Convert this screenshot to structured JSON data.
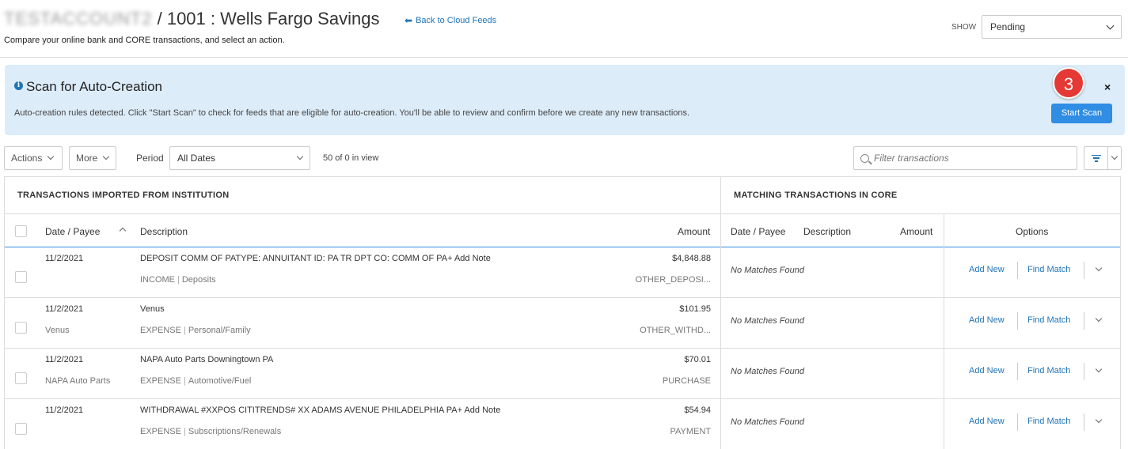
{
  "header": {
    "account_name": "TESTACCOUNT2",
    "title": "/ 1001 : Wells Fargo Savings",
    "back_link": "Back to Cloud Feeds",
    "subtitle": "Compare your online bank and CORE transactions, and select an action.",
    "show_label": "SHOW",
    "show_value": "Pending"
  },
  "banner": {
    "title": "Scan for Auto-Creation",
    "text": "Auto-creation rules detected. Click \"Start Scan\" to check for feeds that are eligible for auto-creation. You'll be able to review and confirm before we create any new transactions.",
    "step_number": "3",
    "close": "×",
    "start_scan": "Start Scan"
  },
  "toolbar": {
    "actions": "Actions",
    "more": "More",
    "period_label": "Period",
    "period_value": "All Dates",
    "in_view": "50 of 0 in view",
    "filter_placeholder": "Filter transactions"
  },
  "table": {
    "group_left": "TRANSACTIONS IMPORTED FROM INSTITUTION",
    "group_right": "MATCHING TRANSACTIONS IN CORE",
    "col_date": "Date / Payee",
    "col_desc": "Description",
    "col_amount": "Amount",
    "col_core_date": "Date / Payee",
    "col_core_desc": "Description",
    "col_core_amount": "Amount",
    "col_options": "Options",
    "add_new": "Add New",
    "find_match": "Find Match",
    "no_match": "No Matches Found",
    "rows": [
      {
        "date": "11/2/2021",
        "payee": "",
        "desc": "DEPOSIT COMM OF PATYPE: ANNUITANT ID: PA TR DPT CO: COMM OF PA+ Add Note",
        "cat": "INCOME",
        "subcat": "Deposits",
        "amount": "$4,848.88",
        "type": "OTHER_DEPOSI..."
      },
      {
        "date": "11/2/2021",
        "payee": "Venus",
        "desc": "Venus",
        "cat": "EXPENSE",
        "subcat": "Personal/Family",
        "amount": "$101.95",
        "type": "OTHER_WITHD..."
      },
      {
        "date": "11/2/2021",
        "payee": "NAPA Auto Parts",
        "desc": "NAPA Auto Parts Downingtown PA",
        "cat": "EXPENSE",
        "subcat": "Automotive/Fuel",
        "amount": "$70.01",
        "type": "PURCHASE"
      },
      {
        "date": "11/2/2021",
        "payee": "",
        "desc": "WITHDRAWAL #XXPOS CITITRENDS# XX ADAMS AVENUE PHILADELPHIA PA+ Add Note",
        "cat": "EXPENSE",
        "subcat": "Subscriptions/Renewals",
        "amount": "$54.94",
        "type": "PAYMENT"
      }
    ]
  },
  "colors": {
    "accent": "#2f8de4",
    "link": "#1f73b7",
    "banner_bg": "#dcecf9",
    "badge": "#e53935"
  }
}
